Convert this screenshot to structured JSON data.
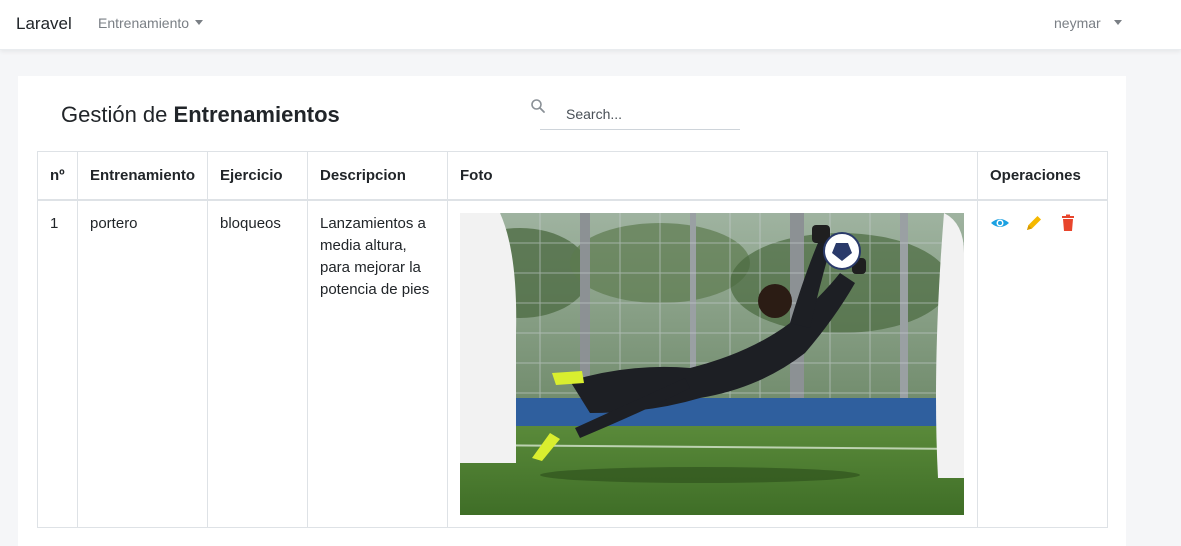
{
  "navbar": {
    "brand": "Laravel",
    "menu_label": "Entrenamiento",
    "user_label": "neymar"
  },
  "page": {
    "title_prefix": "Gestión de ",
    "title_strong": "Entrenamientos"
  },
  "search": {
    "placeholder": "Search...",
    "icon": "search-icon"
  },
  "table": {
    "headers": [
      "nº",
      "Entrenamiento",
      "Ejercicio",
      "Descripcion",
      "Foto",
      "Operaciones"
    ],
    "rows": [
      {
        "n": "1",
        "entrenamiento": "portero",
        "ejercicio": "bloqueos",
        "descripcion": "Lanzamientos a media altura, para mejorar la potencia de pies",
        "foto": "goalkeeper-diving-photo",
        "operaciones": [
          "eye-icon",
          "pencil-icon",
          "trash-icon"
        ]
      }
    ]
  },
  "colors": {
    "view": "#1ba1e2",
    "edit": "#f5b800",
    "delete": "#e8452c"
  }
}
